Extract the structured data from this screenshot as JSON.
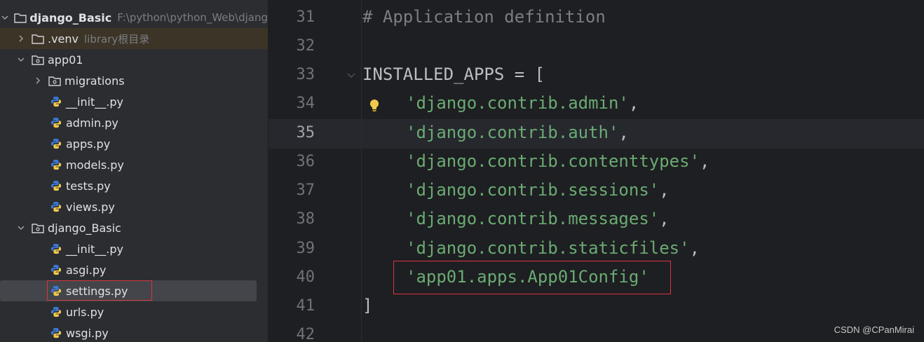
{
  "project_tree": {
    "root": {
      "name": "django_Basic",
      "path": "F:\\python\\python_Web\\djang"
    },
    "items": [
      {
        "label": "django_Basic"
      },
      {
        "label": ".venv",
        "hint": "library根目录"
      },
      {
        "label": "app01"
      },
      {
        "label": "migrations"
      },
      {
        "label": "__init__.py"
      },
      {
        "label": "admin.py"
      },
      {
        "label": "apps.py"
      },
      {
        "label": "models.py"
      },
      {
        "label": "tests.py"
      },
      {
        "label": "views.py"
      },
      {
        "label": "django_Basic"
      },
      {
        "label": "__init__.py"
      },
      {
        "label": "asgi.py"
      },
      {
        "label": "settings.py"
      },
      {
        "label": "urls.py"
      },
      {
        "label": "wsgi.py"
      }
    ]
  },
  "editor": {
    "line_numbers": [
      "31",
      "32",
      "33",
      "34",
      "35",
      "36",
      "37",
      "38",
      "39",
      "40",
      "41",
      "42"
    ],
    "lines": {
      "l31_comment": "# Application definition",
      "l33_code": "INSTALLED_APPS = [",
      "l34_str": "'django.contrib.admin'",
      "l35_str": "'django.contrib.auth'",
      "l36_str": "'django.contrib.contenttypes'",
      "l37_str": "'django.contrib.sessions'",
      "l38_str": "'django.contrib.messages'",
      "l39_str": "'django.contrib.staticfiles'",
      "l40_str": "'app01.apps.App01Config'",
      "l41_code": "]",
      "comma": ","
    }
  },
  "watermark": "CSDN @CPanMirai",
  "colors": {
    "tree_bg": "#2b2d30",
    "editor_bg": "#1e1f22",
    "string": "#6aab73",
    "comment": "#7a7e85",
    "highlight_box": "#d9363e",
    "python_blue": "#3c78d8",
    "python_yellow": "#f2c94c"
  }
}
